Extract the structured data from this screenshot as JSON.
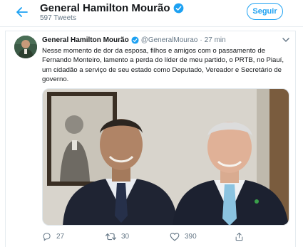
{
  "header": {
    "name": "General Hamilton Mourão",
    "tweet_count": "597 Tweets",
    "follow_label": "Seguir"
  },
  "tweet": {
    "author_name": "General Hamilton Mourão",
    "handle": "@GeneralMourao",
    "separator": "·",
    "time": "27 min",
    "text": "Nesse momento de dor da esposa, filhos e amigos com o passamento de Fernando Monteiro, lamento a perda do líder de meu partido, o PRTB, no Piauí, um cidadão a serviço de seu estado como Deputado, Vereador e Secretário de governo.",
    "actions": {
      "replies": "27",
      "retweets": "30",
      "likes": "390"
    }
  },
  "colors": {
    "accent": "#1da1f2",
    "secondary_text": "#657786",
    "border": "#e6ecf0"
  },
  "icons": [
    "back-arrow-icon",
    "verified-badge-icon",
    "chevron-down-icon",
    "reply-icon",
    "retweet-icon",
    "like-icon",
    "share-icon"
  ]
}
